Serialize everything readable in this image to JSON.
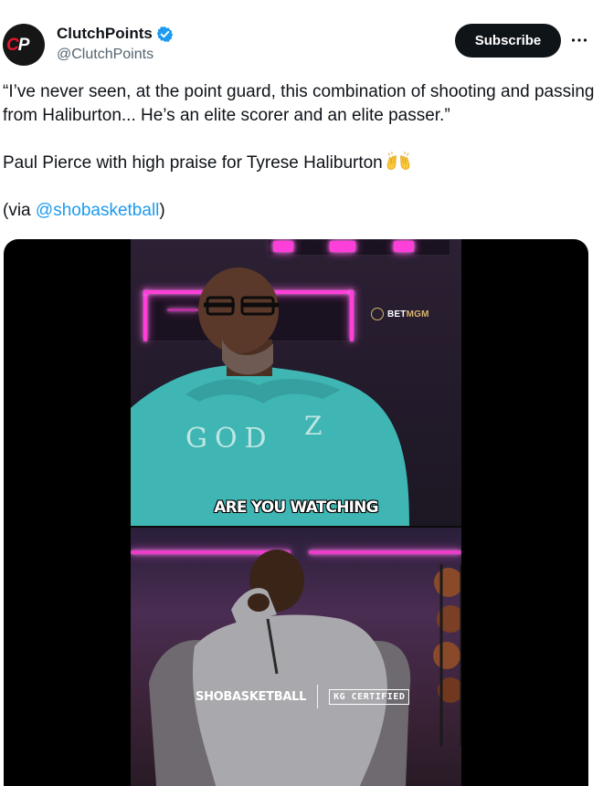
{
  "account": {
    "display_name": "ClutchPoints",
    "handle": "@ClutchPoints",
    "avatar_text_c": "C",
    "avatar_text_p": "P",
    "verified": true
  },
  "actions": {
    "subscribe_label": "Subscribe",
    "more_icon": "more-horizontal-icon"
  },
  "tweet": {
    "line1": "“I’ve never seen, at the point guard, this combination of shooting and passing from Haliburton... He’s an elite scorer and an elite passer.”",
    "line2": "Paul Pierce with high praise for Tyrese Haliburton",
    "line2_emoji": "raising-hands-emoji",
    "via_prefix": "(via ",
    "via_mention": "@shobasketball",
    "via_suffix": ")"
  },
  "media": {
    "sponsor_prefix": "BET",
    "sponsor_suffix": "MGM",
    "caption": "ARE YOU WATCHING",
    "shirt_text": "GODZ",
    "brand_left": "SHOBASKETBALL",
    "brand_right": "KG CERTIFIED"
  },
  "colors": {
    "text": "#0f1419",
    "secondary": "#536471",
    "link": "#1d9bf0",
    "button_bg": "#0f1419",
    "verified": "#1d9bf0",
    "neon": "#ff3fd9",
    "hoodie": "#3fb6b4"
  }
}
